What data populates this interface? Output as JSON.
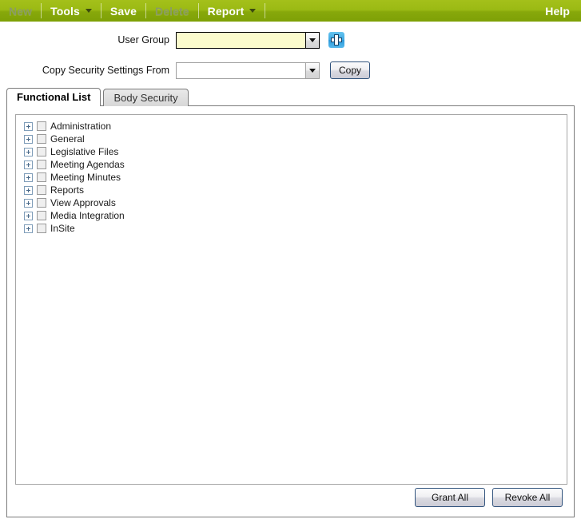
{
  "toolbar": {
    "items": [
      {
        "label": "New",
        "enabled": false,
        "has_caret": false
      },
      {
        "label": "Tools",
        "enabled": true,
        "has_caret": true
      },
      {
        "label": "Save",
        "enabled": true,
        "has_caret": false
      },
      {
        "label": "Delete",
        "enabled": false,
        "has_caret": false
      },
      {
        "label": "Report",
        "enabled": true,
        "has_caret": true
      }
    ],
    "help_label": "Help",
    "background_top": "#a4c01a",
    "background_bottom": "#7ea006",
    "disabled_color": "#8a9c62"
  },
  "form": {
    "user_group": {
      "label": "User Group",
      "value": "",
      "placeholder": "",
      "required_bg": "#fbfbcd"
    },
    "copy_from": {
      "label": "Copy Security Settings From",
      "value": "",
      "placeholder": ""
    },
    "add_button_title": "Add",
    "copy_button_label": "Copy",
    "dropdown_icon": "chevron-down-icon",
    "add_icon": "plus-icon"
  },
  "tabs": [
    {
      "label": "Functional List",
      "active": true
    },
    {
      "label": "Body Security",
      "active": false
    }
  ],
  "functional_list": {
    "items": [
      {
        "label": "Administration",
        "checked": false,
        "expanded": false
      },
      {
        "label": "General",
        "checked": false,
        "expanded": false
      },
      {
        "label": "Legislative Files",
        "checked": false,
        "expanded": false
      },
      {
        "label": "Meeting Agendas",
        "checked": false,
        "expanded": false
      },
      {
        "label": "Meeting Minutes",
        "checked": false,
        "expanded": false
      },
      {
        "label": "Reports",
        "checked": false,
        "expanded": false
      },
      {
        "label": "View Approvals",
        "checked": false,
        "expanded": false
      },
      {
        "label": "Media Integration",
        "checked": false,
        "expanded": false
      },
      {
        "label": "InSite",
        "checked": false,
        "expanded": false
      }
    ],
    "expander_icon": "plus-square-icon",
    "checkbox_icon": "checkbox-icon"
  },
  "actions": {
    "grant_all_label": "Grant All",
    "revoke_all_label": "Revoke All"
  }
}
